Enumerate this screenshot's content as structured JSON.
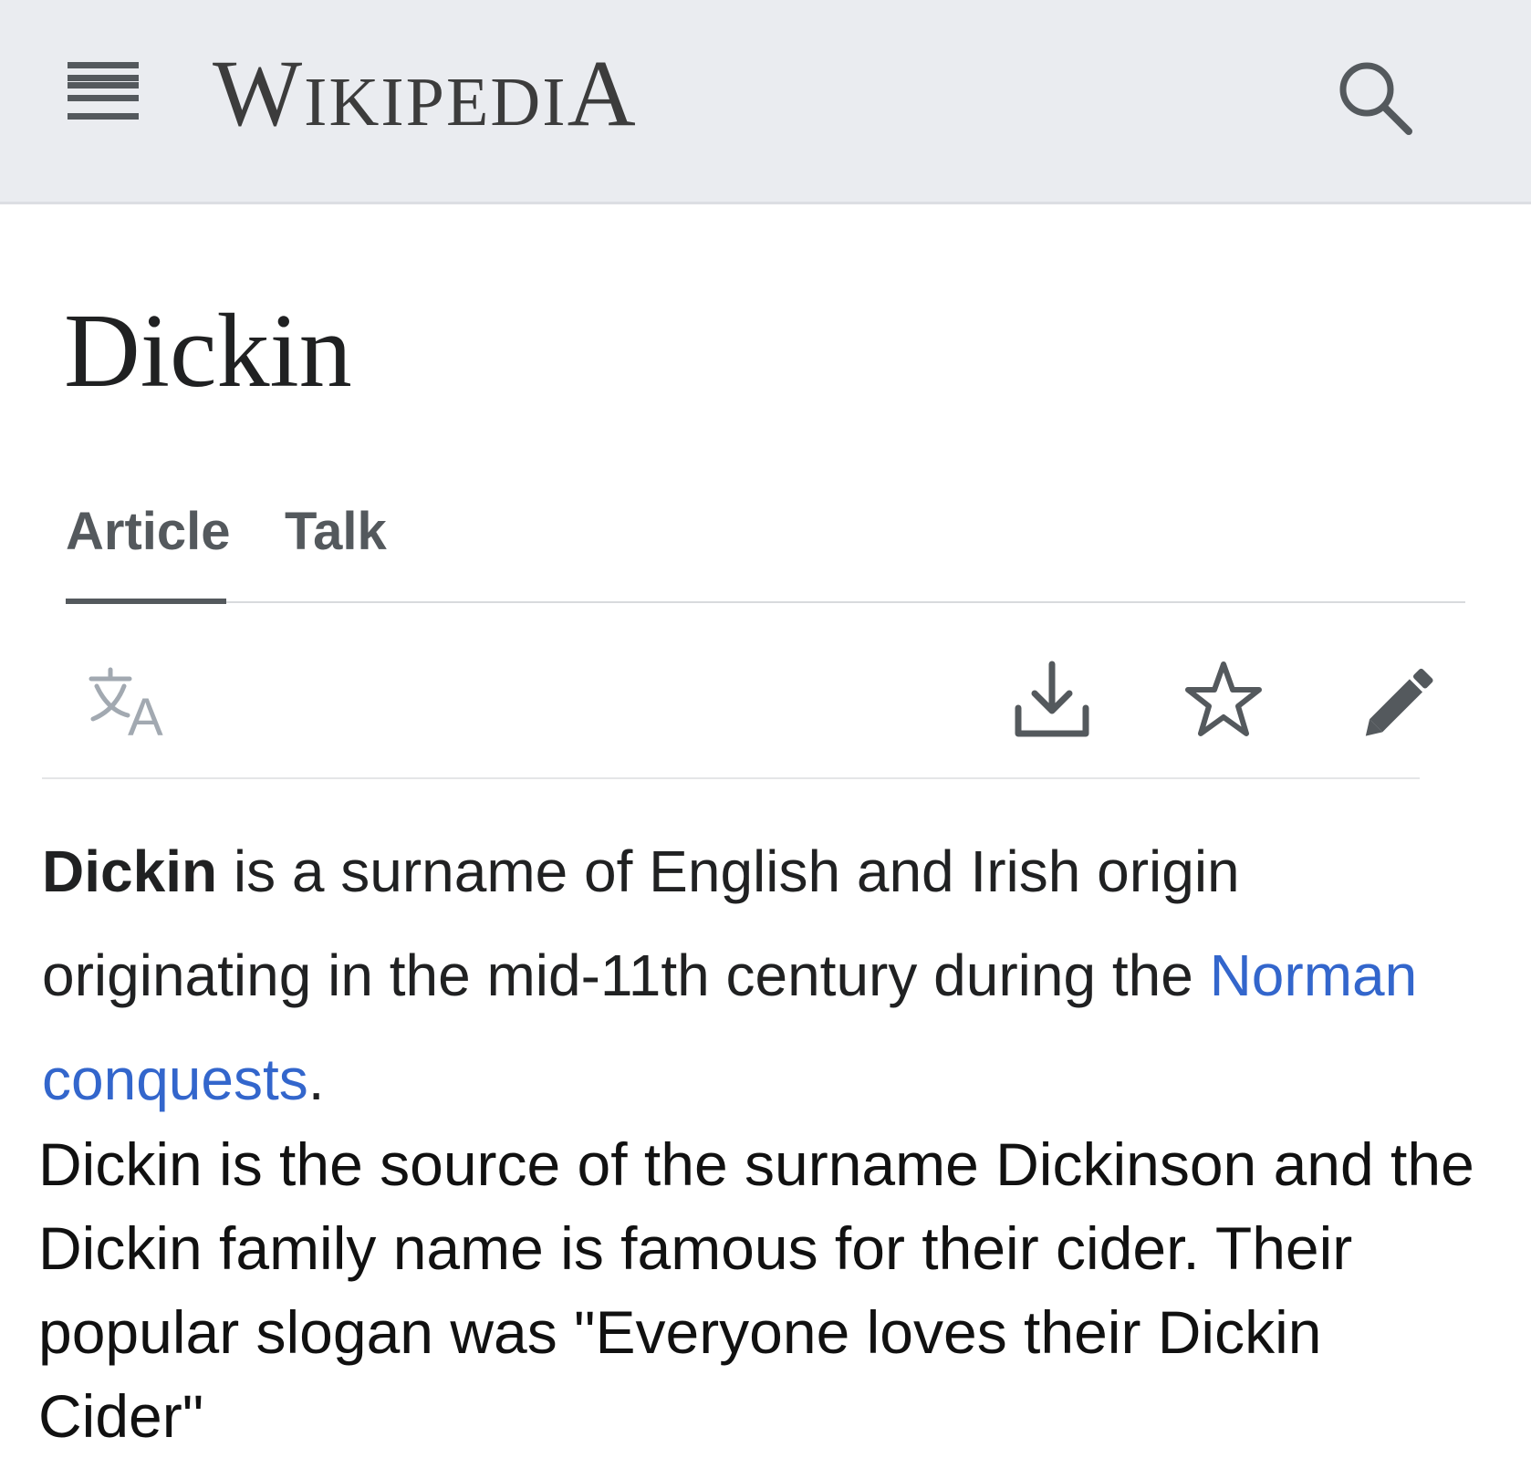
{
  "header": {
    "logo_text": "Wikipedia",
    "menu_icon": "hamburger-menu-icon",
    "search_icon": "search-icon",
    "background": "#eaecf0"
  },
  "article": {
    "title": "Dickin"
  },
  "tabs": [
    {
      "label": "Article",
      "active": true
    },
    {
      "label": "Talk",
      "active": false
    }
  ],
  "page_actions": {
    "language_icon": "translate-icon",
    "download_icon": "download-icon",
    "watch_icon": "star-icon",
    "edit_icon": "pencil-icon"
  },
  "content": {
    "lead_bold": "Dickin",
    "lead_text": " is a surname of English and Irish origin originating in the mid-11th century during the ",
    "lead_link": "Norman conquests",
    "lead_end": ".",
    "body": "Dickin is the source of the surname Dickinson and the Dickin family name is famous for their cider. Their popular slogan was \"Everyone loves their Dickin Cider\""
  },
  "colors": {
    "link": "#3366cc",
    "text": "#202122",
    "icon": "#54595d"
  }
}
